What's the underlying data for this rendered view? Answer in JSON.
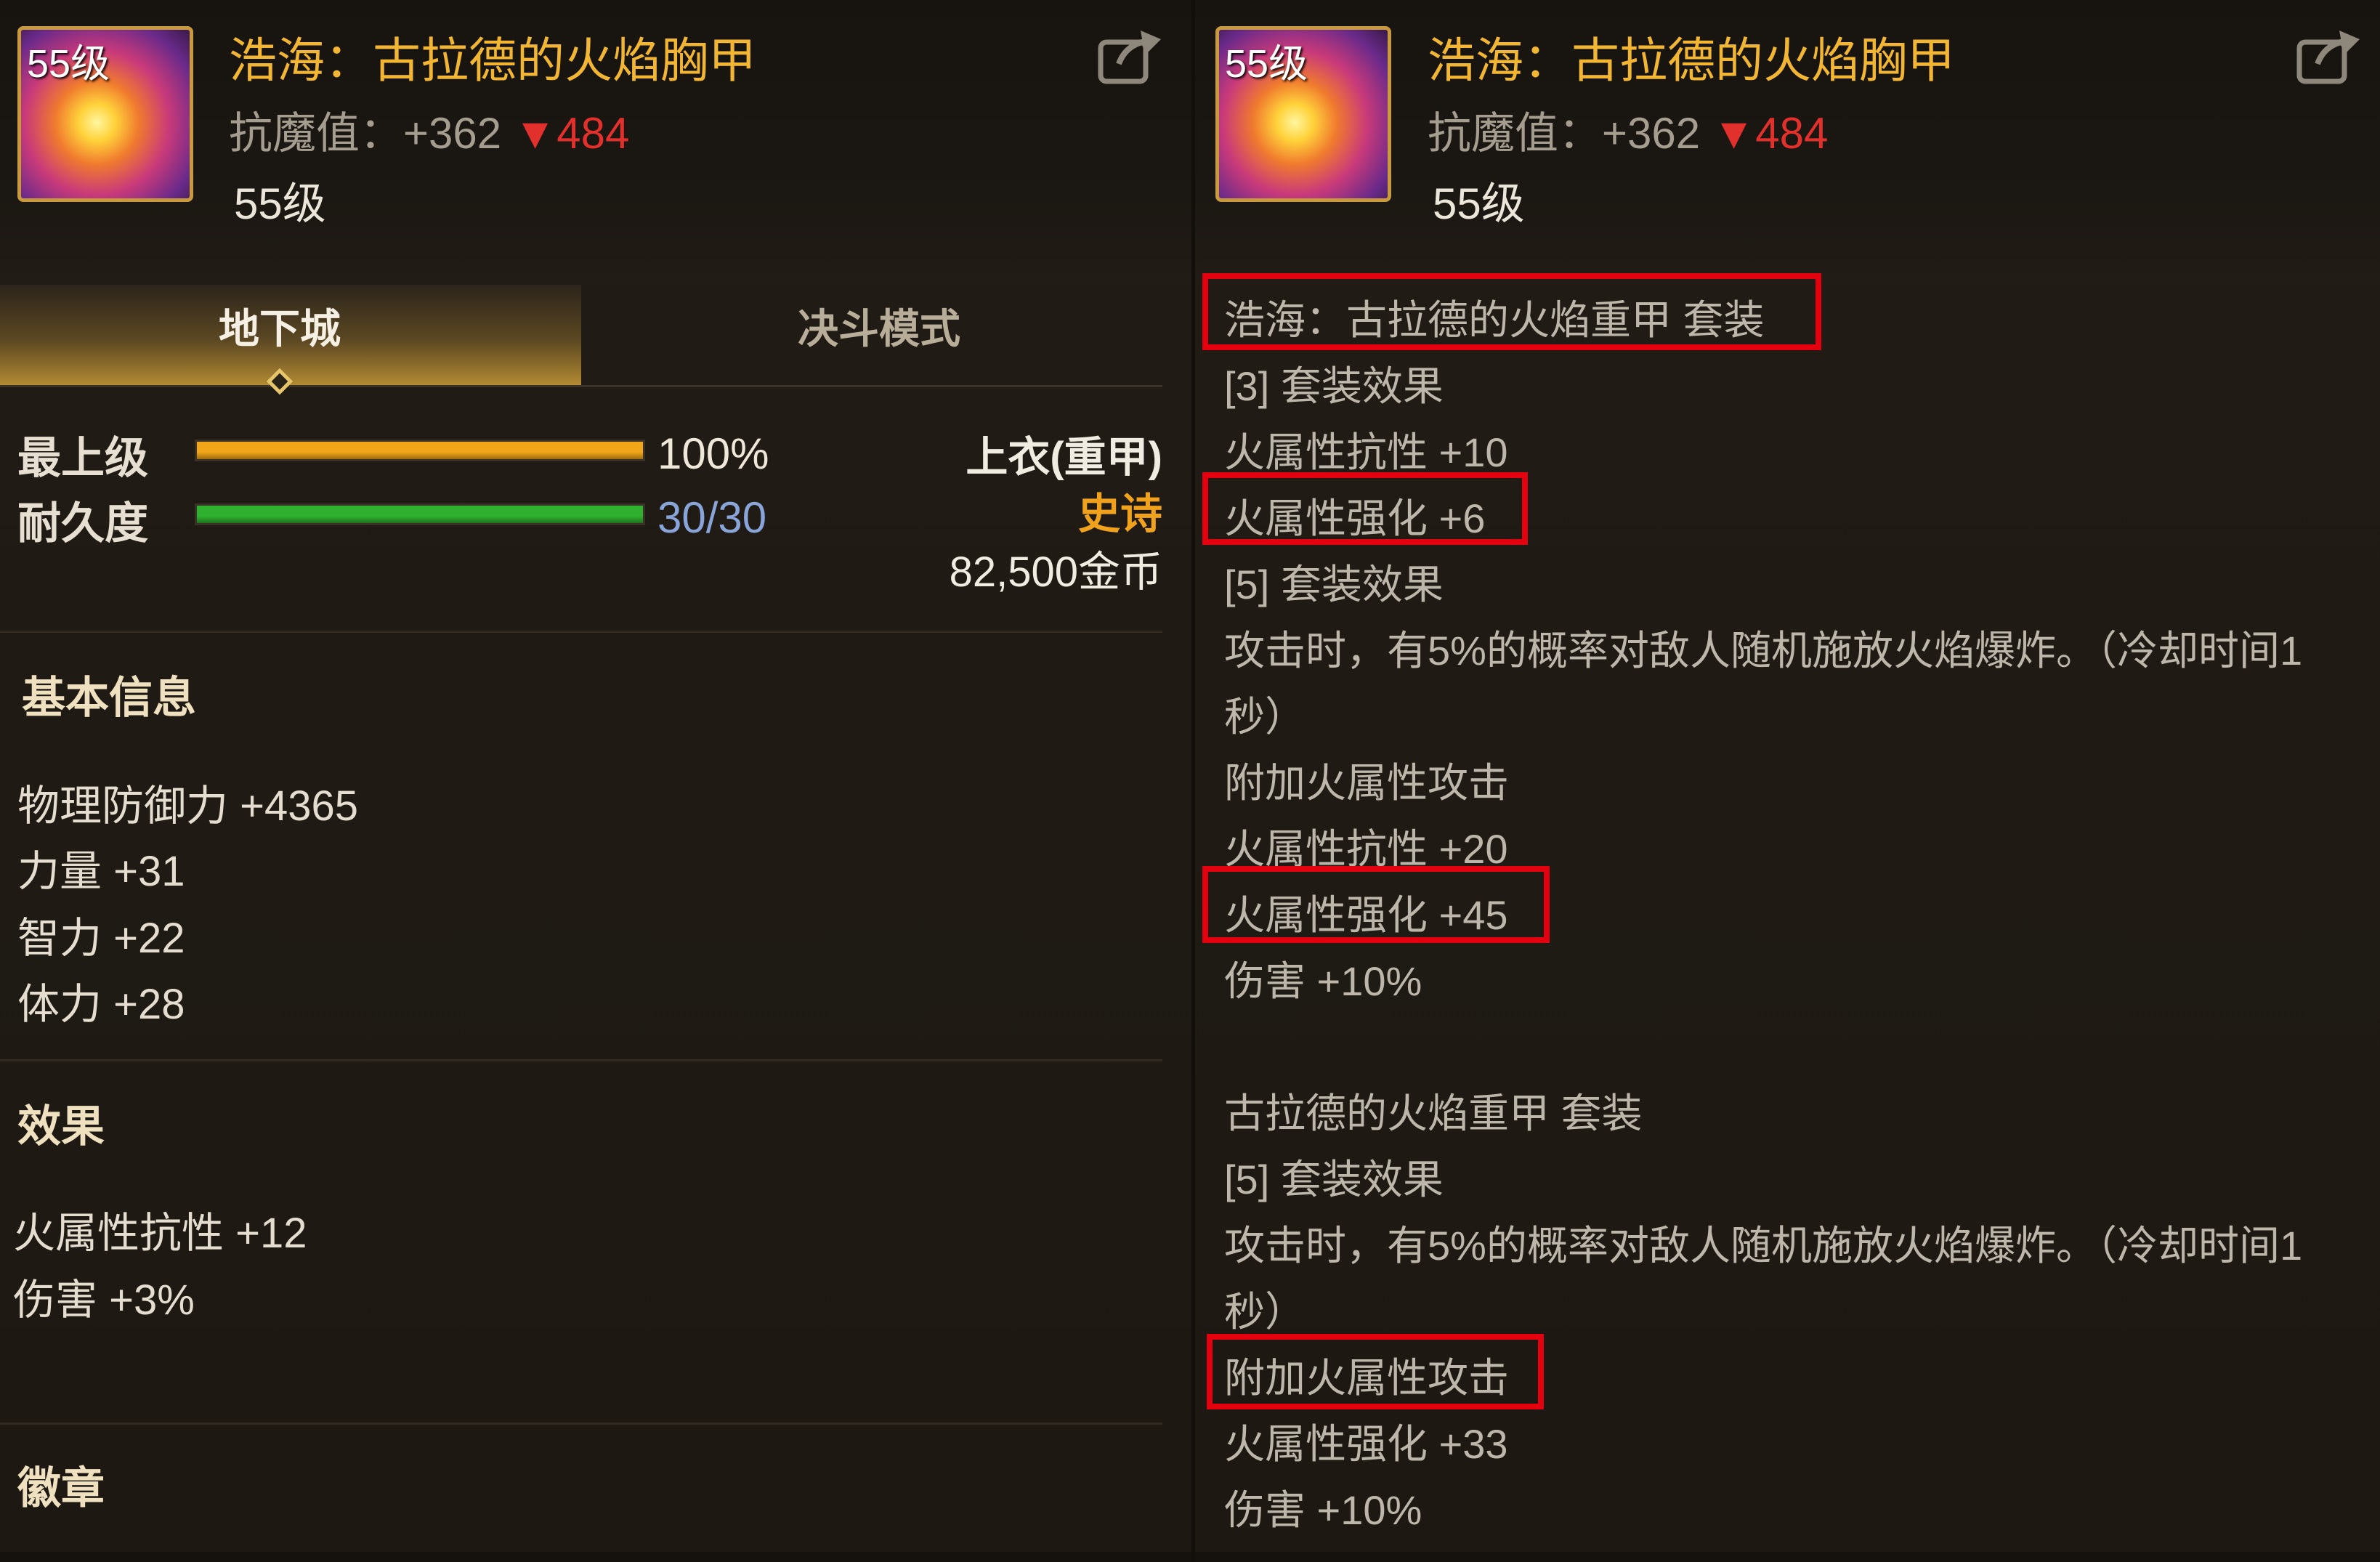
{
  "item": {
    "level_badge": "55级",
    "title": "浩海：古拉德的火焰胸甲",
    "resist_label": "抗魔值：",
    "resist_value": "+362",
    "resist_arrow": "▼",
    "resist_down": "484",
    "level": "55级"
  },
  "tabs": [
    {
      "label": "地下城",
      "active": true
    },
    {
      "label": "决斗模式",
      "active": false
    }
  ],
  "bars": {
    "upgrade": {
      "label": "最上级",
      "value_text": "100%",
      "fraction": 1.0,
      "color": "#f1a619"
    },
    "durability": {
      "label": "耐久度",
      "value_text": "30/30",
      "fraction": 1.0,
      "color": "#2fb12f"
    }
  },
  "meta": {
    "slot": "上衣(重甲)",
    "rarity": "史诗",
    "price": "82,500金币"
  },
  "sections": {
    "basic_title": "基本信息",
    "basic_stats": [
      "物理防御力 +4365",
      "力量 +31",
      "智力 +22",
      "体力 +28"
    ],
    "effect_title": "效果",
    "effect_stats": [
      "火属性抗性 +12",
      "伤害 +3%"
    ],
    "emblem_title": "徽章"
  },
  "set_info": {
    "lines": [
      "浩海：古拉德的火焰重甲  套装",
      "[3] 套装效果",
      "火属性抗性 +10",
      "火属性强化 +6",
      "[5] 套装效果",
      "攻击时，有5%的概率对敌人随机施放火焰爆炸。（冷却时间1",
      "秒）",
      "附加火属性攻击",
      "火属性抗性 +20",
      "火属性强化 +45",
      "伤害 +10%",
      "古拉德的火焰重甲  套装",
      "[5] 套装效果",
      "攻击时，有5%的概率对敌人随机施放火焰爆炸。（冷却时间1",
      "秒）",
      "附加火属性攻击",
      "火属性强化 +33",
      "伤害 +10%"
    ]
  },
  "colors": {
    "title_gold": "#f2b633",
    "resist_red": "#e2312d",
    "rarity_orange": "#f0a21c",
    "durability_blue": "#88a4d8",
    "highlight_red": "#e4000f"
  }
}
